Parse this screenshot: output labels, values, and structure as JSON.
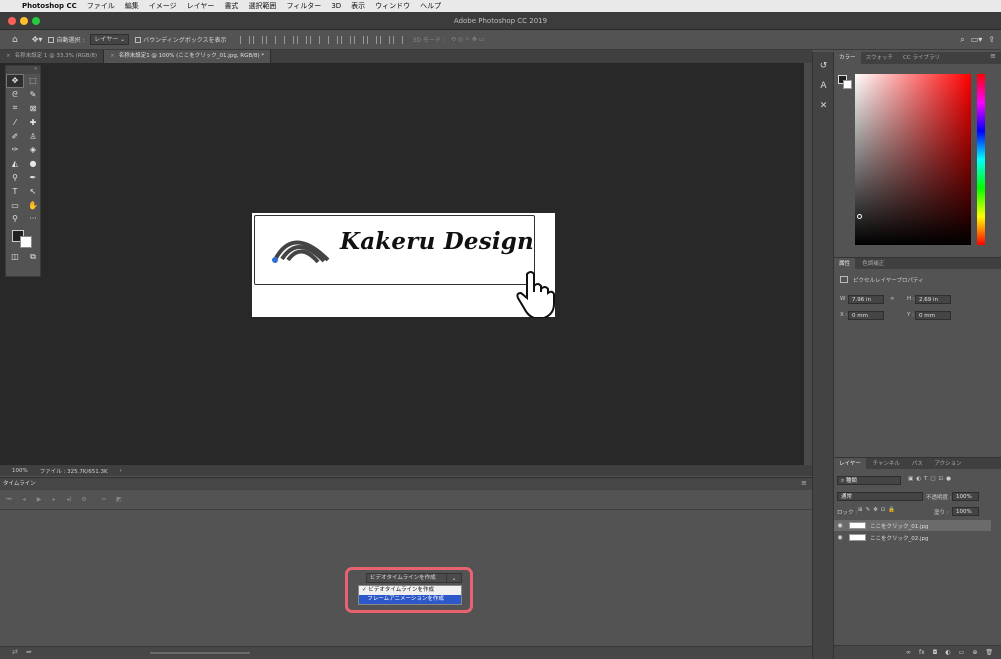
{
  "menubar": {
    "apple": "",
    "app": "Photoshop CC",
    "items": [
      "ファイル",
      "編集",
      "イメージ",
      "レイヤー",
      "書式",
      "選択範囲",
      "フィルター",
      "3D",
      "表示",
      "ウィンドウ",
      "ヘルプ"
    ]
  },
  "window": {
    "title": "Adobe Photoshop CC 2019"
  },
  "options": {
    "auto_select": "自動選択 :",
    "layer_dropdown": "レイヤー",
    "bounding_box": "バウンディングボックスを表示",
    "mode_3d": "3D モード :"
  },
  "tabs": [
    {
      "label": "名称未設定 1 @ 33.3% (RGB/8)"
    },
    {
      "label": "名称未設定1 @ 100% (ここをクリック_01.jpg, RGB/8) *"
    }
  ],
  "canvas": {
    "logo_text": "Kakeru Design",
    "accent_color": "#2f6fd1"
  },
  "status": {
    "zoom": "100%",
    "file": "ファイル : 325.7K/651.3K"
  },
  "timeline": {
    "tab_label": "タイムライン",
    "select_value": "ビデオタイムラインを作成",
    "menu_items": [
      {
        "label": "ビデオタイムラインを作成",
        "checked": true
      },
      {
        "label": "フレームアニメーションを作成",
        "checked": false
      }
    ],
    "highlight_color": "#e8636f"
  },
  "color_panel": {
    "tabs": [
      "カラー",
      "スウォッチ",
      "CC ライブラリ"
    ]
  },
  "properties": {
    "tabs": [
      "属性",
      "色調補正"
    ],
    "heading": "ピクセルレイヤープロパティ",
    "w_label": "W :",
    "w_value": "7.96 in",
    "h_label": "H :",
    "h_value": "2.69 in",
    "x_label": "X :",
    "x_value": "0 mm",
    "y_label": "Y :",
    "y_value": "0 mm"
  },
  "layers_panel": {
    "tabs": [
      "レイヤー",
      "チャンネル",
      "パス",
      "アクション"
    ],
    "kind": "種類",
    "blend_mode": "通常",
    "opacity_label": "不透明度 :",
    "opacity_value": "100%",
    "lock_label": "ロック :",
    "fill_label": "塗り :",
    "fill_value": "100%",
    "layers": [
      {
        "name": "ここをクリック_01.jpg"
      },
      {
        "name": "ここをクリック_02.jpg"
      }
    ]
  }
}
